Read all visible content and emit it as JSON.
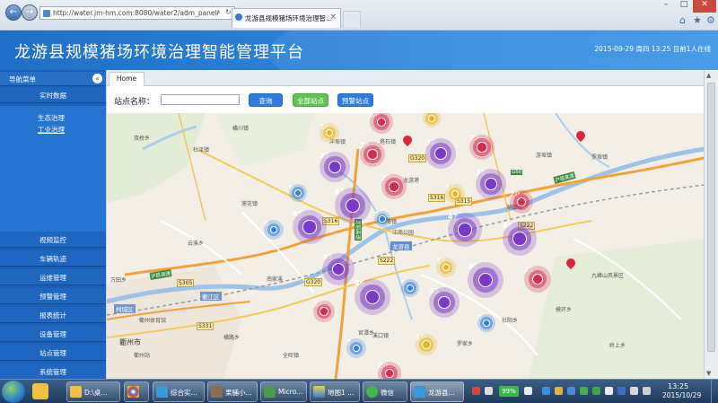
{
  "browser": {
    "address": "http://water.jm-hm.com:8080/water2/adm_panel/",
    "tab_title": "龙游县规模猪场环境治理智...",
    "back_glyph": "←",
    "forward_glyph": "→",
    "close_tab_glyph": "×"
  },
  "header": {
    "title": "龙游县规模猪场环境治理智能管理平台",
    "datetime": "2015-09-29 周四 13:25 目前1人在线"
  },
  "sidebar": {
    "title": "导航菜单",
    "items": [
      {
        "label": "实时数据"
      },
      {
        "label": "生态治理"
      },
      {
        "label": "工业治理"
      },
      {
        "label": "视频监控"
      },
      {
        "label": "车辆轨迹"
      },
      {
        "label": "运维管理"
      },
      {
        "label": "预警管理"
      },
      {
        "label": "报表统计"
      },
      {
        "label": "设备管理"
      },
      {
        "label": "站点管理"
      },
      {
        "label": "系统管理"
      }
    ]
  },
  "content": {
    "tab_home": "Home",
    "search_label": "站点名称：",
    "search_value": "",
    "buttons": {
      "query": "查询",
      "all_sites": "全部站点",
      "alert_sites": "预警站点"
    }
  },
  "map": {
    "labels": [
      {
        "text": "双桥乡"
      },
      {
        "text": "杜泽镇"
      },
      {
        "text": "横川镇"
      },
      {
        "text": "莲花镇"
      },
      {
        "text": "云溪乡"
      },
      {
        "text": "南家溪"
      },
      {
        "text": "万田乡"
      },
      {
        "text": "衢江区"
      },
      {
        "text": "柯城区"
      },
      {
        "text": "衢州市"
      },
      {
        "text": "衢州体育馆"
      },
      {
        "text": "衢州站"
      },
      {
        "text": "塔石镇"
      },
      {
        "text": "洋埠镇"
      },
      {
        "text": "罗埠镇"
      },
      {
        "text": "游埠镇"
      },
      {
        "text": "湖镇镇"
      },
      {
        "text": "溪口镇"
      },
      {
        "text": "横路乡"
      },
      {
        "text": "全旺镇"
      },
      {
        "text": "罗家乡"
      },
      {
        "text": "社阳乡"
      },
      {
        "text": "九峰山风景区"
      },
      {
        "text": "官潭乡"
      },
      {
        "text": "模环乡"
      },
      {
        "text": "岭上乡"
      },
      {
        "text": "江南公园"
      },
      {
        "text": "南海镇"
      }
    ],
    "county_badge": "龙游县",
    "road_codes": [
      "G320",
      "G60",
      "S316",
      "S315",
      "S305",
      "G320",
      "S222",
      "S331",
      "S222",
      "S316"
    ],
    "highway_labels": [
      "沪昆高速",
      "沪昆高速",
      "龙丽高速",
      "龙游港"
    ],
    "clusters": [
      {
        "count": "26",
        "color": "red"
      },
      {
        "count": "15",
        "color": "yellow"
      },
      {
        "count": "16",
        "color": "yellow"
      },
      {
        "count": "36",
        "color": "red"
      },
      {
        "count": "32",
        "color": "purple"
      },
      {
        "count": "22",
        "color": "red"
      },
      {
        "count": "38",
        "color": "purple"
      },
      {
        "count": "22",
        "color": "red"
      },
      {
        "count": "36",
        "color": "purple"
      },
      {
        "count": "11",
        "color": "yellow"
      },
      {
        "count": "20",
        "color": "red"
      },
      {
        "count": "9",
        "color": "blue"
      },
      {
        "count": "81",
        "color": "purple"
      },
      {
        "count": "7",
        "color": "blue"
      },
      {
        "count": "6",
        "color": "blue"
      },
      {
        "count": "48",
        "color": "purple"
      },
      {
        "count": "47",
        "color": "purple"
      },
      {
        "count": "48",
        "color": "purple"
      },
      {
        "count": "33",
        "color": "purple"
      },
      {
        "count": "11",
        "color": "yellow"
      },
      {
        "count": "30",
        "color": "purple"
      },
      {
        "count": "22",
        "color": "red"
      },
      {
        "count": "46",
        "color": "purple"
      },
      {
        "count": "5",
        "color": "blue"
      },
      {
        "count": "33",
        "color": "purple"
      },
      {
        "count": "21",
        "color": "red"
      },
      {
        "count": "3",
        "color": "blue"
      },
      {
        "count": "3",
        "color": "blue"
      },
      {
        "count": "19",
        "color": "yellow"
      },
      {
        "count": "20",
        "color": "red"
      }
    ]
  },
  "taskbar": {
    "items": [
      {
        "label": "D:\\桌..."
      },
      {
        "label": ""
      },
      {
        "label": "综合实..."
      },
      {
        "label": "果脯小..."
      },
      {
        "label": "Micro..."
      },
      {
        "label": "地图1 ..."
      },
      {
        "label": "微信"
      },
      {
        "label": "龙游县..."
      }
    ],
    "battery": "99%",
    "time": "13:25",
    "date": "2015/10/29"
  },
  "colors": {
    "header_blue": "#1e6fc8",
    "sidebar_blue": "#1b60b8",
    "query_button": "#2f7be0",
    "all_sites_button": "#5fc251",
    "cluster_red": "#d72a4f",
    "cluster_purple": "#7a39c9",
    "cluster_yellow": "#e8b417",
    "cluster_blue": "#2d7fe0"
  }
}
